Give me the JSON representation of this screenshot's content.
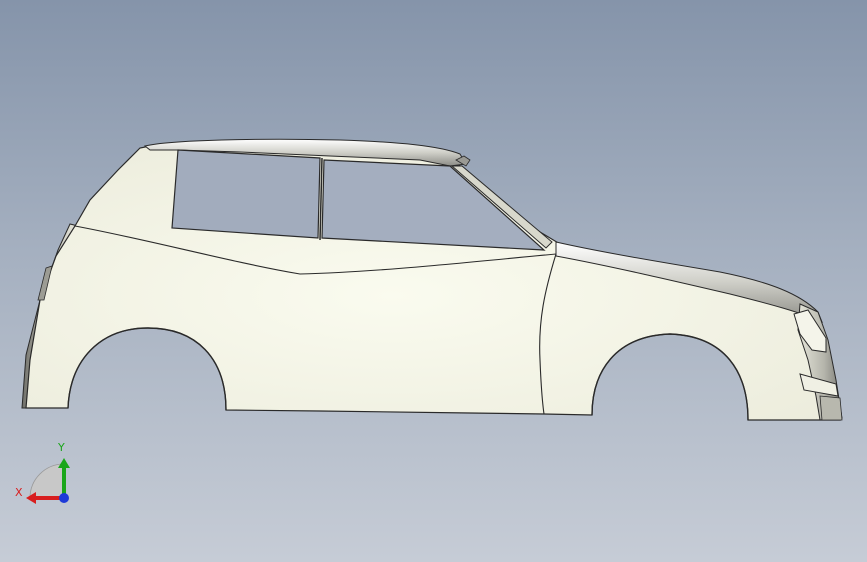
{
  "viewport": {
    "background_top": "#8594aa",
    "background_bottom": "#c6ccd6"
  },
  "model": {
    "body_color": "#f6f7ea",
    "roof_color": "#c9c9c2",
    "edge_color": "#2a2a2a"
  },
  "triad": {
    "x_label": "X",
    "y_label": "Y",
    "x_color": "#d81e1e",
    "y_color": "#1aa61a",
    "z_color": "#1e3ad8"
  }
}
